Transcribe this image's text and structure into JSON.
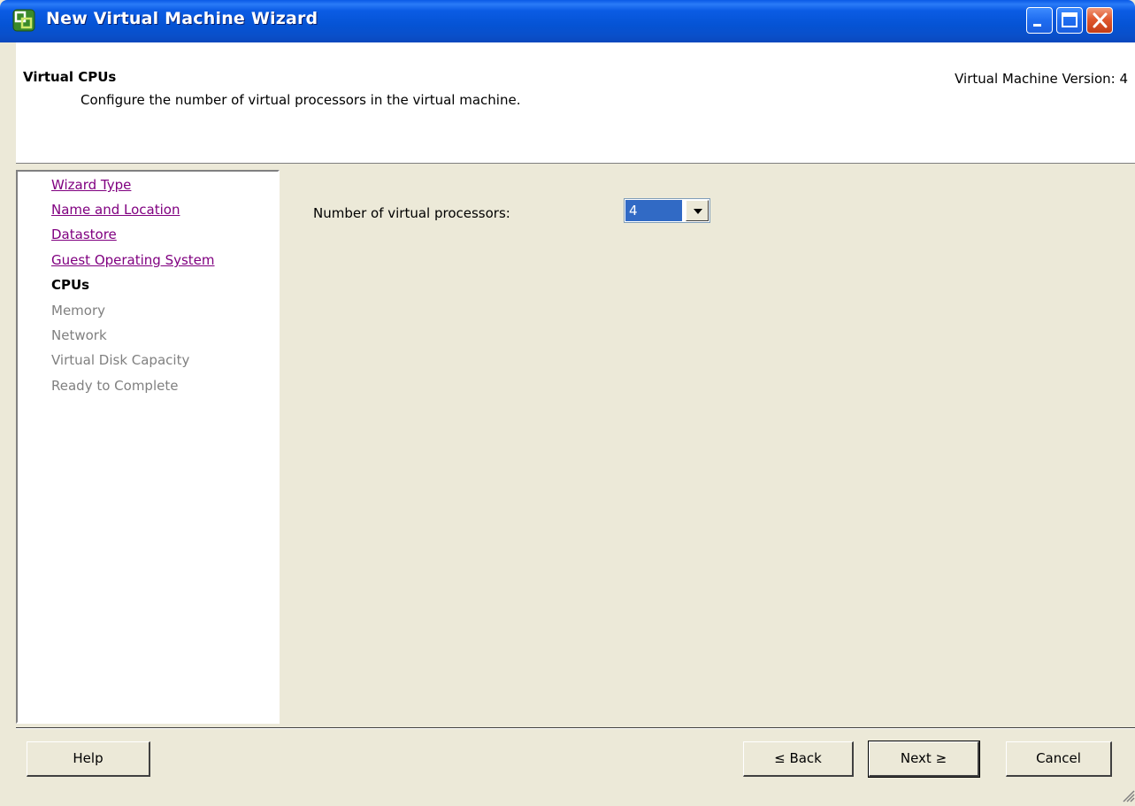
{
  "window": {
    "title": "New Virtual Machine Wizard"
  },
  "header": {
    "title": "Virtual CPUs",
    "description": "Configure the number of virtual processors in the virtual machine.",
    "version": "Virtual Machine Version: 4"
  },
  "nav": {
    "items": [
      {
        "label": "Wizard Type",
        "state": "done"
      },
      {
        "label": "Name and Location",
        "state": "done"
      },
      {
        "label": "Datastore",
        "state": "done"
      },
      {
        "label": "Guest Operating System",
        "state": "done"
      },
      {
        "label": "CPUs",
        "state": "current"
      },
      {
        "label": "Memory",
        "state": "future"
      },
      {
        "label": "Network",
        "state": "future"
      },
      {
        "label": "Virtual Disk Capacity",
        "state": "future"
      },
      {
        "label": "Ready to Complete",
        "state": "future"
      }
    ]
  },
  "main": {
    "cpu_label": "Number of virtual processors:",
    "cpu_value": "4"
  },
  "footer": {
    "help": "Help",
    "back": "≤ Back",
    "next": "Next ≥",
    "cancel": "Cancel"
  },
  "colors": {
    "titlebar": "#0553d4",
    "visited_link": "#800080",
    "disabled_text": "#808080",
    "selection": "#316ac5",
    "dialog_bg": "#ece9d8"
  },
  "icons": [
    "vm-wizard-icon",
    "minimize-icon",
    "maximize-icon",
    "close-icon",
    "dropdown-arrow-icon",
    "resize-grip-icon"
  ]
}
